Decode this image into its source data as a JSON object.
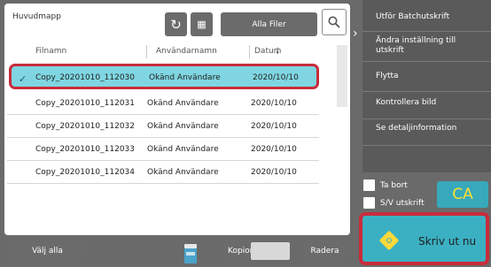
{
  "left_panel": {
    "folder": "Huvudmapp",
    "filter": "Alla Filer",
    "icons": {
      "refresh": "refresh-icon",
      "grid": "grid-view-icon",
      "search": "search-icon",
      "sort": "sort-desc-icon"
    },
    "columns": [
      "Filnamn",
      "Användarnamn",
      "Datum"
    ],
    "rows": [
      {
        "name": "Copy_20201010_112030",
        "user": "Okänd Användare",
        "date": "2020/10/10",
        "selected": true
      },
      {
        "name": "Copy_20201010_112031",
        "user": "Okänd Användare",
        "date": "2020/10/10"
      },
      {
        "name": "Copy_20201010_112032",
        "user": "Okänd Användare",
        "date": "2020/10/10"
      },
      {
        "name": "Copy_20201010_112033",
        "user": "Okänd Användare",
        "date": "2020/10/10"
      },
      {
        "name": "Copy_20201010_112034",
        "user": "Okänd Användare",
        "date": "2020/10/10"
      }
    ]
  },
  "sidebar": {
    "items": [
      "Utför Batchutskrift",
      "Ändra inställning till utskrift",
      "Flytta",
      "Kontrollera bild",
      "Se detaljinformation"
    ]
  },
  "options": {
    "delete_label": "Ta bort",
    "bw_label": "S/V utskrift",
    "ca": "CA"
  },
  "bottom": {
    "select_all": "Välj alla",
    "copies": "Kopior",
    "delete": "Radera",
    "print": "Skriv ut nu"
  },
  "colors": {
    "accent": "#3bb0c2",
    "highlight": "#c92b3a",
    "selected_row": "#7fd6e2"
  }
}
